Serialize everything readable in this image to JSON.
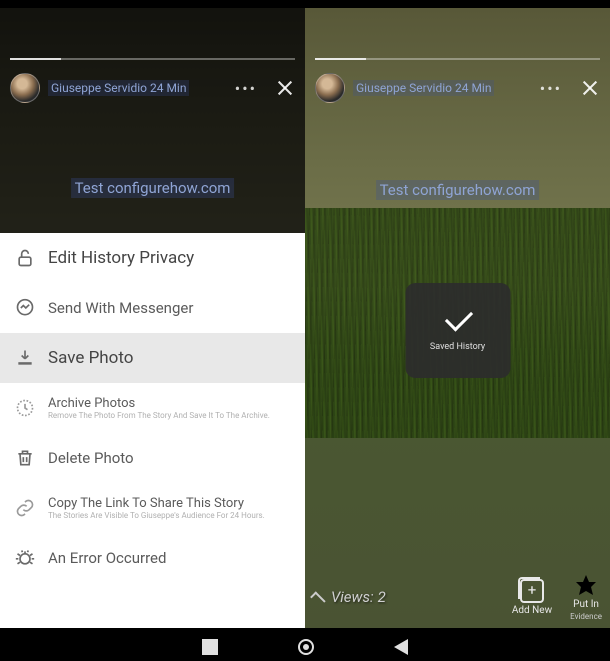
{
  "left": {
    "user": "Giuseppe Servidio 24 Min",
    "watermark": "Test configurehow.com",
    "sheet": {
      "edit": "Edit History Privacy",
      "messenger": "Send With Messenger",
      "save": "Save Photo",
      "archive": {
        "title": "Archive Photos",
        "sub": "Remove The Photo From The Story And Save It To The Archive."
      },
      "delete": "Delete Photo",
      "copy": {
        "title": "Copy The Link To Share This Story",
        "sub": "The Stories Are Visible To Giuseppe's Audience For 24 Hours."
      },
      "error": "An Error Occurred"
    }
  },
  "right": {
    "user": "Giuseppe Servidio 24 Min",
    "watermark": "Test configurehow.com",
    "toast": "Saved History",
    "views_label": "Views:",
    "views_count": "2",
    "add_new": "Add New",
    "highlight": "Put In",
    "highlight_sub": "Evidence"
  }
}
